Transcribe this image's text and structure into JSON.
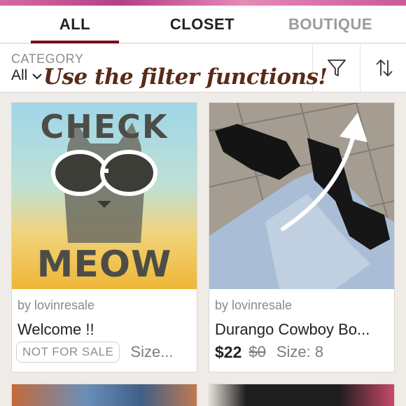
{
  "tabs": [
    {
      "label": "ALL"
    },
    {
      "label": "CLOSET"
    },
    {
      "label": "BOUTIQUE"
    }
  ],
  "filters": {
    "category_label": "CATEGORY",
    "category_value": "All",
    "filter_icon": "funnel-icon",
    "sort_icon": "sort-arrows-icon"
  },
  "annotation": "Use the filter functions!",
  "listings": [
    {
      "image_text_top": "CHECK",
      "image_text_bottom": "MEOW",
      "seller": "by lovinresale",
      "title": "Welcome !!",
      "badge": "NOT FOR SALE",
      "size": "Size..."
    },
    {
      "seller": "by lovinresale",
      "title": "Durango Cowboy Bo...",
      "price": "$22",
      "original_price": "$0",
      "size": "Size: 8"
    }
  ],
  "colors": {
    "accent": "#7f0019",
    "annotation": "#5a2a18"
  }
}
